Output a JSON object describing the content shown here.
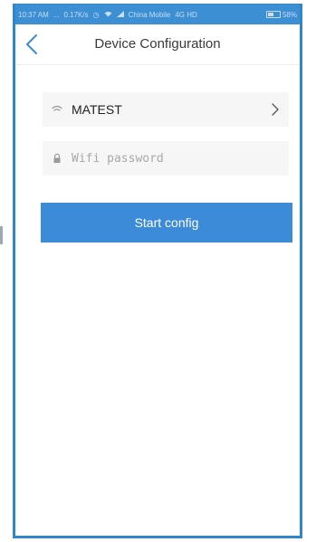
{
  "status_bar": {
    "time": "10:37 AM",
    "dots": "...",
    "speed": "0.17K/s",
    "carrier": "China Mobile",
    "network": "4G HD",
    "battery": "58%"
  },
  "nav": {
    "title": "Device Configuration",
    "back_icon": "chevron-left-icon"
  },
  "wifi": {
    "ssid": "MATEST",
    "icon": "wifi-icon",
    "chevron_icon": "chevron-right-icon"
  },
  "password": {
    "placeholder": "Wifi password",
    "value": "",
    "icon": "lock-icon"
  },
  "actions": {
    "start_label": "Start config"
  },
  "colors": {
    "accent": "#3c8bd9",
    "status_bar": "#3d8fd4",
    "field_bg": "#f6f6f6"
  }
}
